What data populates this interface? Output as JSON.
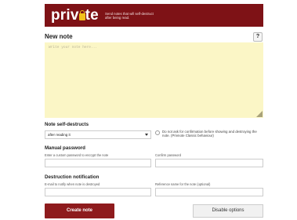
{
  "header": {
    "logo_text_left": "priv",
    "logo_text_right": "te",
    "tagline": "Send notes that will self-destruct after being read."
  },
  "note": {
    "title": "New note",
    "help": "?",
    "placeholder": "Write your note here..."
  },
  "self_destruct": {
    "label": "Note self-destructs",
    "selected": "after reading it",
    "confirm_text": "Do not ask for confirmation before showing and destroying the note. (Privnote Classic behaviour)"
  },
  "password": {
    "label": "Manual password",
    "hint": "Enter a custom password to encrypt the note",
    "confirm_hint": "Confirm password"
  },
  "notification": {
    "label": "Destruction notification",
    "email_hint": "E-mail to notify when note is destroyed",
    "reference_hint": "Reference name for the note (optional)"
  },
  "actions": {
    "create": "Create note",
    "disable": "Disable options"
  },
  "colors": {
    "brand": "#7e1216",
    "note_bg": "#fbf6c6",
    "create_button": "#8e1b1d"
  }
}
